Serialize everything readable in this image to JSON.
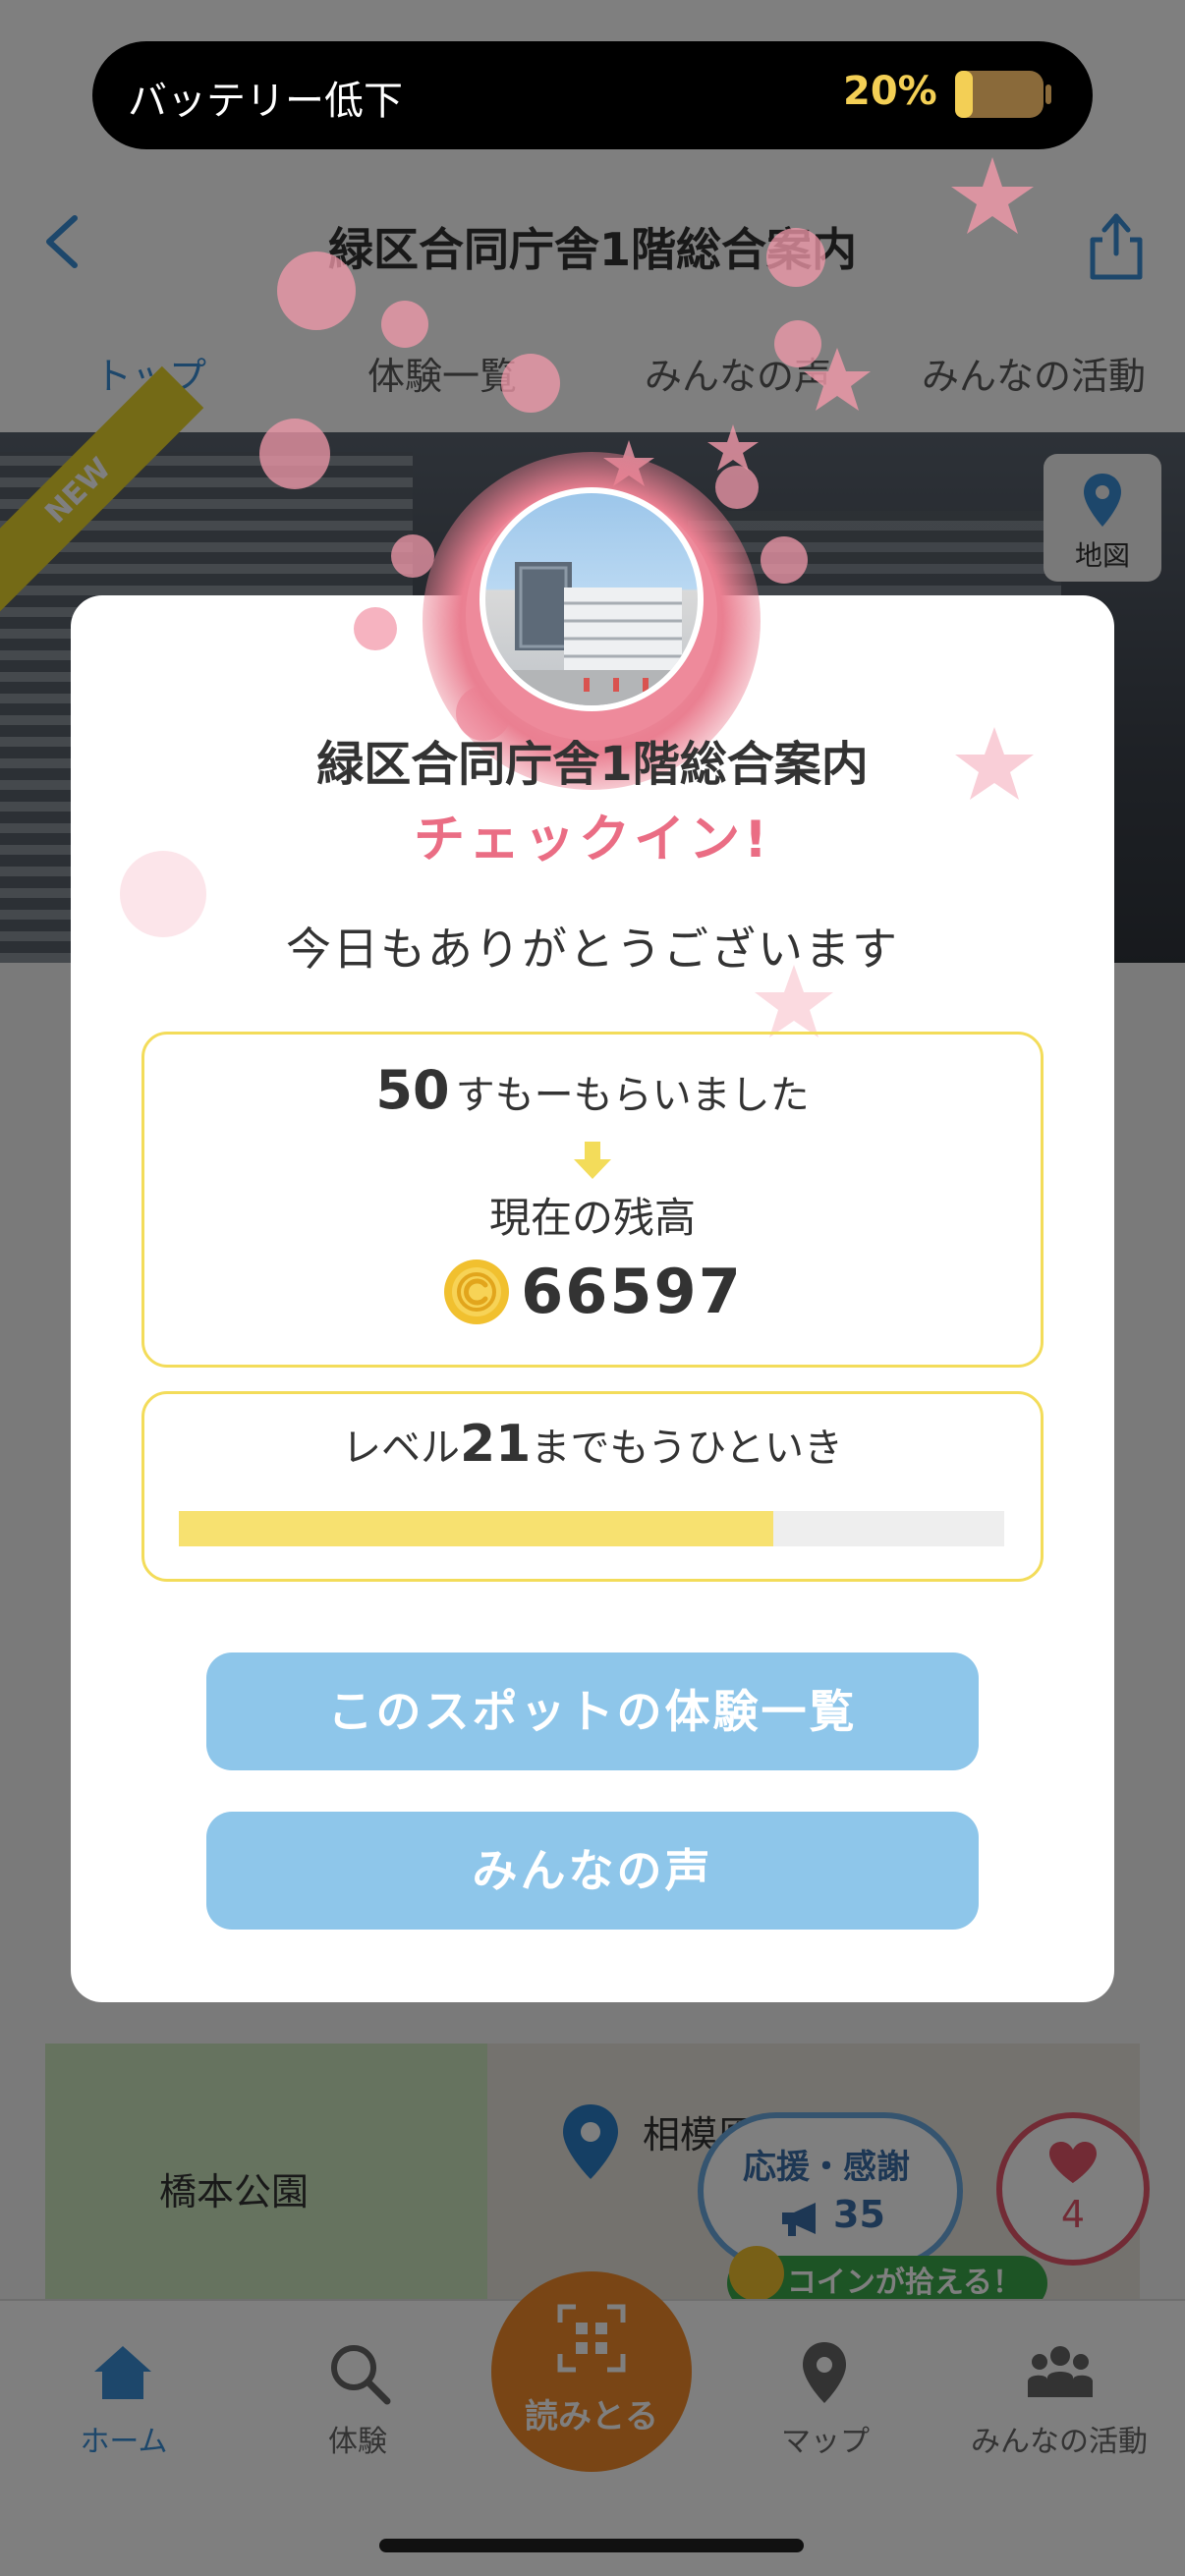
{
  "status_banner": {
    "label": "バッテリー低下",
    "percent": "20%",
    "battery_level": 0.2
  },
  "header": {
    "title": "緑区合同庁舎1階総合案内"
  },
  "tabs": [
    {
      "label": "トップ",
      "active": true
    },
    {
      "label": "体験一覧",
      "active": false
    },
    {
      "label": "みんなの声",
      "active": false
    },
    {
      "label": "みんなの活動",
      "active": false
    }
  ],
  "hero": {
    "ribbon": "NEW",
    "map_button": "地図"
  },
  "map": {
    "park_label": "橋本公園",
    "place_label": "相模原市...所",
    "cheer_label": "応援・感謝",
    "cheer_count": "35",
    "like_count": "4",
    "coin_hint": "コインが拾える！"
  },
  "tabbar": {
    "items": [
      {
        "label": "ホーム",
        "icon": "home-icon",
        "active": true
      },
      {
        "label": "体験",
        "icon": "search-icon",
        "active": false
      },
      {
        "label": "読みとる",
        "icon": "qr-scan-icon",
        "active": false
      },
      {
        "label": "マップ",
        "icon": "map-pin-icon",
        "active": false
      },
      {
        "label": "みんなの活動",
        "icon": "people-icon",
        "active": false
      }
    ]
  },
  "modal": {
    "spot_name": "緑区合同庁舎1階総合案内",
    "checkin": "チェックイン!",
    "message": "今日もありがとうございます",
    "reward_amount": "50",
    "reward_text": "すもーもらいました",
    "balance_label": "現在の残高",
    "balance_value": "66597",
    "level_prefix": "レベル",
    "level_number": "21",
    "level_suffix": "までもうひといき",
    "level_progress": 0.72,
    "button_experiences": "このスポットの体験一覧",
    "button_voices": "みんなの声"
  },
  "colors": {
    "accent_pink": "#ea6d84",
    "button_blue": "#8ec6ea",
    "box_border_yellow": "#f3dc5a",
    "progress_yellow": "#f7e170",
    "tab_active_blue": "#3a8fd6"
  }
}
